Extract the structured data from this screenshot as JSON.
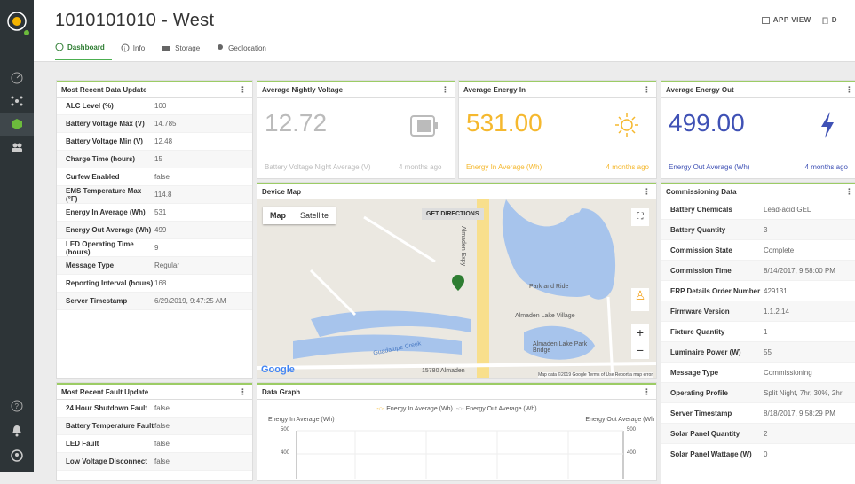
{
  "header": {
    "title": "1010101010 - West",
    "app_view": "APP VIEW",
    "d_label": "D"
  },
  "tabs": [
    {
      "label": "Dashboard"
    },
    {
      "label": "Info"
    },
    {
      "label": "Storage"
    },
    {
      "label": "Geolocation"
    }
  ],
  "recent_data": {
    "title": "Most Recent Data Update",
    "rows": [
      [
        "ALC Level (%)",
        "100"
      ],
      [
        "Battery Voltage Max (V)",
        "14.785"
      ],
      [
        "Battery Voltage Min (V)",
        "12.48"
      ],
      [
        "Charge Time (hours)",
        "15"
      ],
      [
        "Curfew Enabled",
        "false"
      ],
      [
        "EMS Temperature Max (°F)",
        "114.8"
      ],
      [
        "Energy In Average (Wh)",
        "531"
      ],
      [
        "Energy Out Average (Wh)",
        "499"
      ],
      [
        "LED Operating Time (hours)",
        "9"
      ],
      [
        "Message Type",
        "Regular"
      ],
      [
        "Reporting Interval (hours)",
        "168"
      ],
      [
        "Server Timestamp",
        "6/29/2019, 9:47:25 AM"
      ]
    ]
  },
  "fault": {
    "title": "Most Recent Fault Update",
    "rows": [
      [
        "24 Hour Shutdown Fault",
        "false"
      ],
      [
        "Battery Temperature Fault",
        "false"
      ],
      [
        "LED Fault",
        "false"
      ],
      [
        "Low Voltage Disconnect",
        "false"
      ]
    ]
  },
  "nightly": {
    "title": "Average Nightly Voltage",
    "value": "12.72",
    "label": "Battery Voltage Night Average (V)",
    "time": "4 months ago"
  },
  "energy_in": {
    "title": "Average Energy In",
    "value": "531.00",
    "label": "Energy In Average (Wh)",
    "time": "4 months ago"
  },
  "energy_out": {
    "title": "Average Energy Out",
    "value": "499.00",
    "label": "Energy Out Average (Wh)",
    "time": "4 months ago"
  },
  "map": {
    "title": "Device Map",
    "map": "Map",
    "satellite": "Satellite",
    "directions": "GET DIRECTIONS",
    "park": "Park and Ride",
    "village": "Almaden Lake Village",
    "lake": "Almaden Lake Park Bridge",
    "creek": "Guadalupe Creek",
    "expy": "Almaden Expy",
    "address": "15780 Almaden",
    "footer": "Map data ©2019 Google   Terms of Use   Report a map error",
    "google": "Google"
  },
  "commission": {
    "title": "Commissioning Data",
    "rows": [
      [
        "Battery Chemicals",
        "Lead-acid GEL"
      ],
      [
        "Battery Quantity",
        "3"
      ],
      [
        "Commission State",
        "Complete"
      ],
      [
        "Commission Time",
        "8/14/2017, 9:58:00 PM"
      ],
      [
        "ERP Details Order Number",
        "429131"
      ],
      [
        "Firmware Version",
        "1.1.2.14"
      ],
      [
        "Fixture Quantity",
        "1"
      ],
      [
        "Luminaire Power (W)",
        "55"
      ],
      [
        "Message Type",
        "Commissioning"
      ],
      [
        "Operating Profile",
        "Split Night, 7hr, 30%, 2hr"
      ],
      [
        "Server Timestamp",
        "8/18/2017, 9:58:29 PM"
      ],
      [
        "Solar Panel Quantity",
        "2"
      ],
      [
        "Solar Panel Wattage (W)",
        "0"
      ]
    ]
  },
  "graph": {
    "title": "Data Graph",
    "legend_in": "Energy In Average (Wh)",
    "legend_out": "Energy Out Average (Wh)",
    "left_axis": "Energy In Average (Wh)",
    "right_axis": "Energy Out Average (Wh",
    "ticks": [
      "500",
      "400"
    ]
  }
}
